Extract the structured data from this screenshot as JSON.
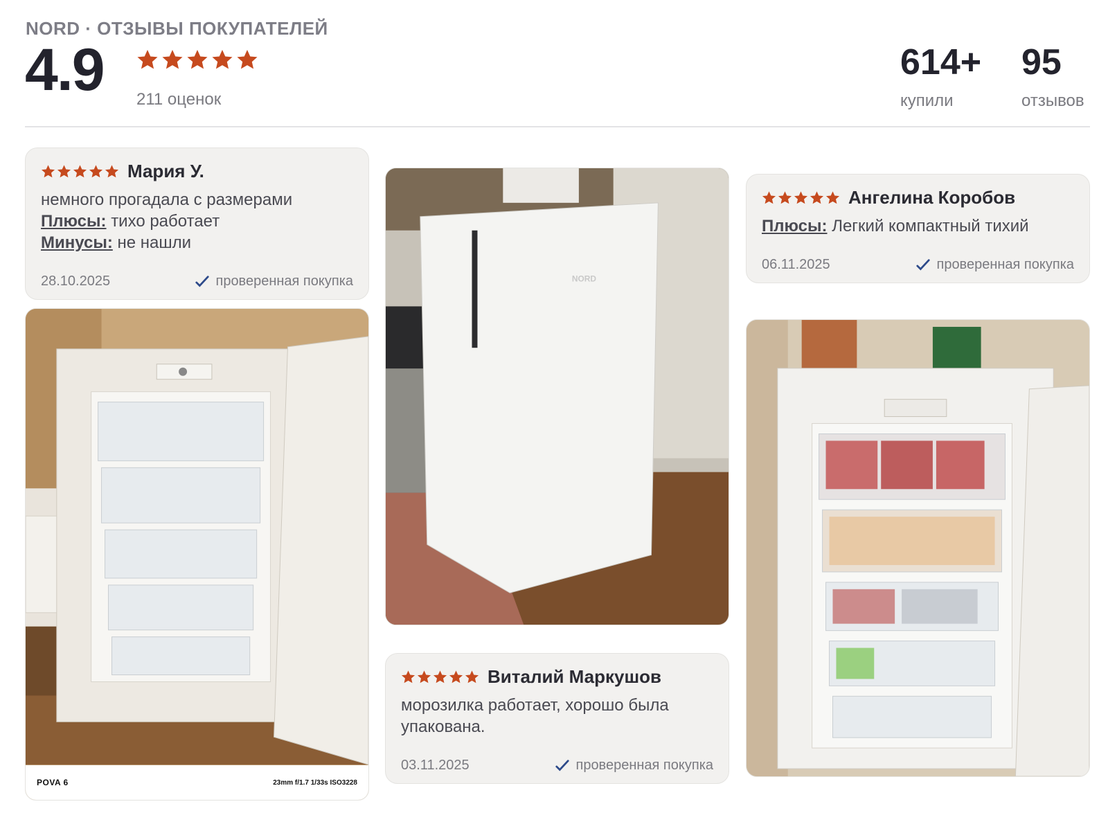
{
  "header": {
    "brand": "NORD · ОТЗЫВЫ ПОКУПАТЕЛЕЙ",
    "rating": "4.9",
    "stars": 5,
    "ratings_count": "211 оценок",
    "stats": [
      {
        "value": "614+",
        "label": "купили"
      },
      {
        "value": "95",
        "label": "отзывов"
      }
    ]
  },
  "reviews": [
    {
      "author": "Мария У.",
      "stars": 5,
      "text": "немного прогадала с размерами",
      "pros_label": "Плюсы:",
      "pros": "тихо работает",
      "cons_label": "Минусы:",
      "cons": "не нашли",
      "date": "28.10.2025",
      "verified": "проверенная покупка"
    },
    {
      "author": "Ангелина Коробов",
      "stars": 5,
      "pros_label": "Плюсы:",
      "pros": "Легкий компактный тихий",
      "date": "06.11.2025",
      "verified": "проверенная покупка"
    },
    {
      "author": "Виталий Маркушов",
      "stars": 5,
      "text_line1": "морозилка работает, хорошо была",
      "text_line2": "упакована.",
      "date": "03.11.2025",
      "verified": "проверенная покупка"
    }
  ],
  "photos": [
    {
      "caption_model": "POVA 6",
      "caption_specs": "23mm f/1.7 1/33s ISO3228"
    },
    {
      "appliance_brand": "NORD"
    }
  ],
  "colors": {
    "star": "#c64a1e",
    "check": "#2d4a8a"
  }
}
